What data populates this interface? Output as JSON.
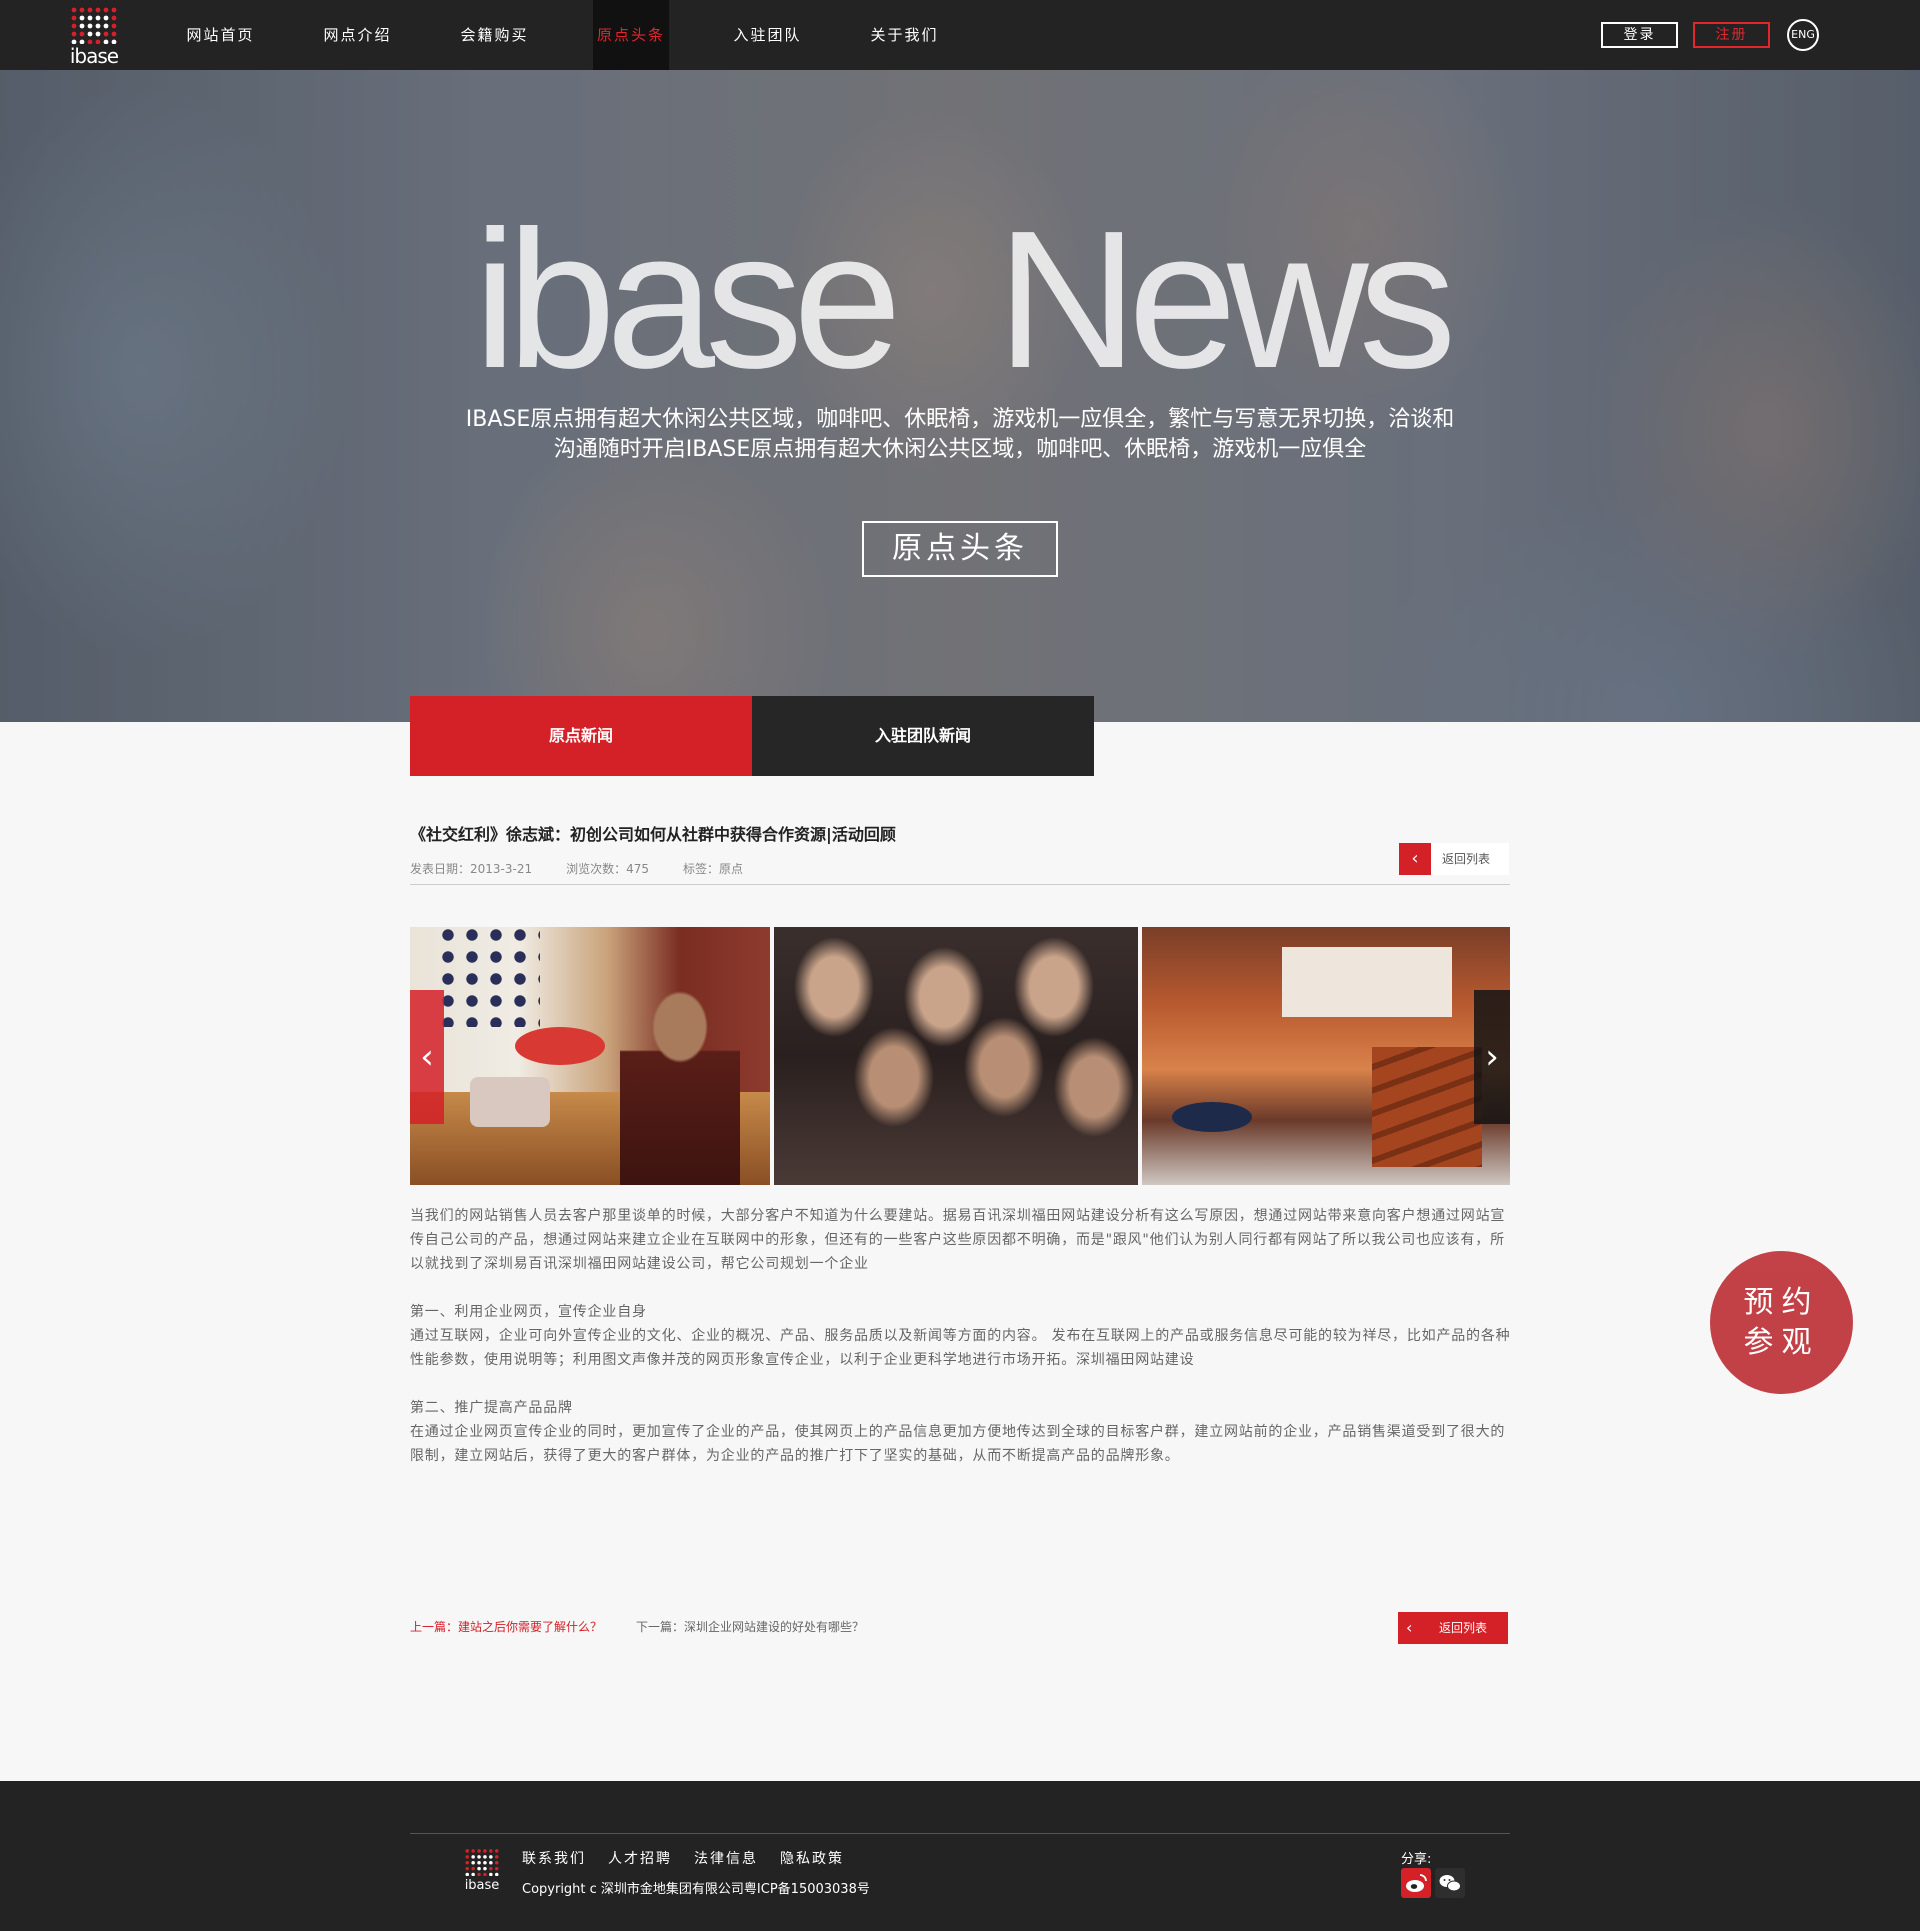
{
  "header": {
    "logo_text": "ibase",
    "nav": [
      "网站首页",
      "网点介绍",
      "会籍购买",
      "原点头条",
      "入驻团队",
      "关于我们"
    ],
    "active_nav_index": 3,
    "login_label": "登录",
    "register_label": "注册",
    "language_label": "ENG"
  },
  "hero": {
    "title": "ibase News",
    "description": "IBASE原点拥有超大休闲公共区域，咖啡吧、休眠椅，游戏机一应俱全，繁忙与写意无界切换，洽谈和沟通随时开启IBASE原点拥有超大休闲公共区域，咖啡吧、休眠椅，游戏机一应俱全",
    "button_label": "原点头条"
  },
  "tabs": [
    "原点新闻",
    "入驻团队新闻"
  ],
  "article": {
    "title": "《社交红利》徐志斌：初创公司如何从社群中获得合作资源|活动回顾",
    "date": "发表日期：2013-3-21",
    "views": "浏览次数：475",
    "tags": "标签：原点",
    "back_label": "返回列表",
    "paragraphs": [
      "当我们的网站销售人员去客户那里谈单的时候，大部分客户不知道为什么要建站。据易百讯深圳福田网站建设分析有这么写原因，想通过网站带来意向客户想通过网站宣传自己公司的产品，想通过网站来建立企业在互联网中的形象，但还有的一些客户这些原因都不明确，而是\"跟风\"他们认为别人同行都有网站了所以我公司也应该有，所以就找到了深圳易百讯深圳福田网站建设公司，帮它公司规划一个企业",
      "第一、利用企业网页，宣传企业自身\n通过互联网，企业可向外宣传企业的文化、企业的概况、产品、服务品质以及新闻等方面的内容。 发布在互联网上的产品或服务信息尽可能的较为祥尽，比如产品的各种性能参数，使用说明等；利用图文声像并茂的网页形象宣传企业，以利于企业更科学地进行市场开拓。深圳福田网站建设",
      "第二、推广提高产品品牌\n在通过企业网页宣传企业的同时，更加宣传了企业的产品，使其网页上的产品信息更加方便地传达到全球的目标客户群，建立网站前的企业，产品销售渠道受到了很大的限制，建立网站后，获得了更大的客户群体，为企业的产品的推广打下了坚实的基础，从而不断提高产品的品牌形象。"
    ],
    "prev_label": "上一篇：建站之后你需要了解什么？",
    "next_label": "下一篇：深圳企业网站建设的好处有哪些？"
  },
  "visit_badge": {
    "line1": "预约",
    "line2": "参观"
  },
  "footer": {
    "logo_text": "ibase",
    "links": [
      "联系我们",
      "人才招聘",
      "法律信息",
      "隐私政策"
    ],
    "copyright": "Copyright c 深圳市金地集团有限公司粤ICP备15003038号",
    "share_label": "分享:"
  },
  "colors": {
    "accent": "#d42027",
    "dark": "#232323"
  }
}
